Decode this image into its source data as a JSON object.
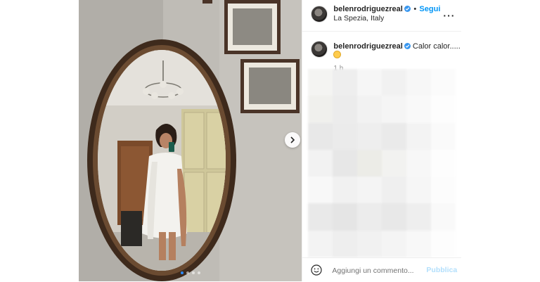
{
  "post": {
    "username": "belenrodriguezreal",
    "follow_separator": "•",
    "follow_label": "Segui",
    "location": "La Spezia, Italy",
    "caption": "Calor calor.....",
    "caption_emoji": "smiling-face-emoji",
    "timestamp": "1 h",
    "carousel": {
      "slides": 4,
      "active_slide": 1
    }
  },
  "comment_bar": {
    "placeholder": "Aggiungi un commento...",
    "publish_label": "Pubblica"
  },
  "icons": [
    "verified-badge-icon",
    "more-options-icon",
    "next-arrow-icon",
    "emoji-icon"
  ],
  "colors": {
    "accent": "#0095f6",
    "publish_disabled": "#b2dffc",
    "verified": "#3897f0"
  }
}
